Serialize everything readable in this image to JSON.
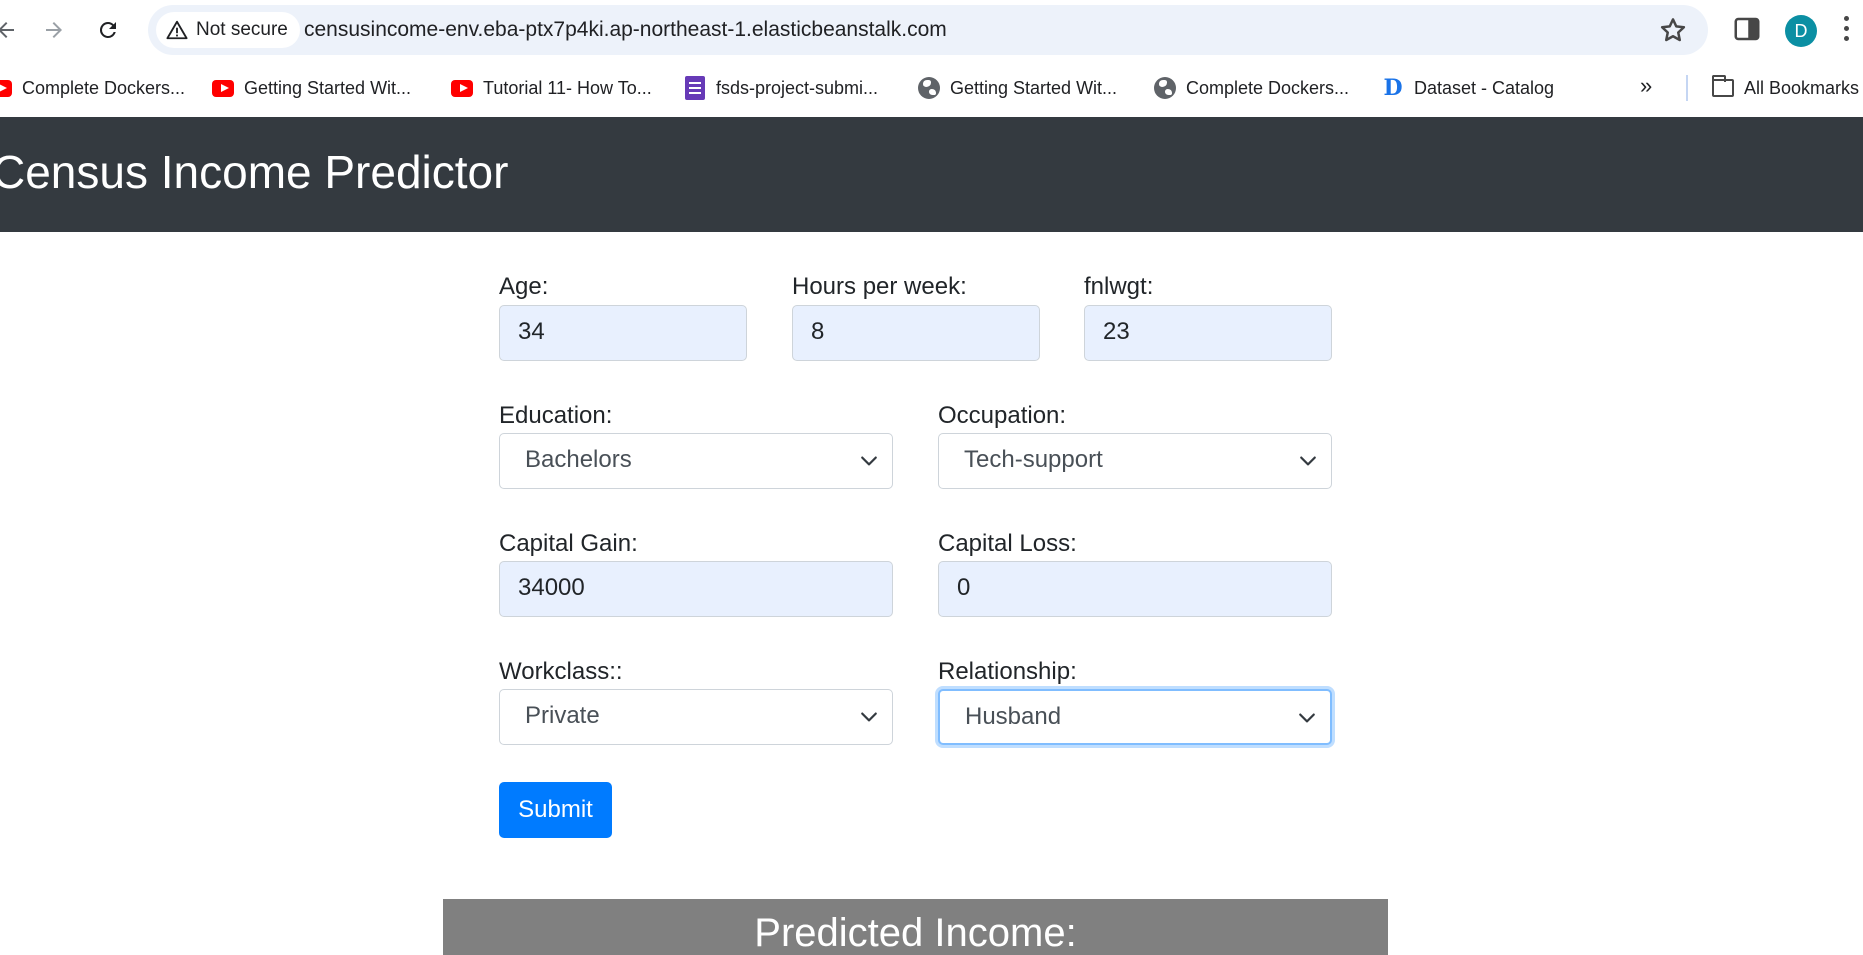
{
  "browser": {
    "security_label": "Not secure",
    "url": "censusincome-env.eba-ptx7p4ki.ap-northeast-1.elasticbeanstalk.com",
    "profile_initial": "D",
    "bookmarks": [
      {
        "label": "Complete Dockers...",
        "icon": "youtube-icon"
      },
      {
        "label": "Getting Started Wit...",
        "icon": "youtube-icon"
      },
      {
        "label": "Tutorial 11- How To...",
        "icon": "youtube-icon"
      },
      {
        "label": "fsds-project-submi...",
        "icon": "google-forms-icon"
      },
      {
        "label": "Getting Started Wit...",
        "icon": "globe-icon"
      },
      {
        "label": "Complete Dockers...",
        "icon": "globe-icon"
      },
      {
        "label": "Dataset - Catalog",
        "icon": "dataset-icon"
      }
    ],
    "more_bookmarks": "»",
    "all_bookmarks": "All Bookmarks"
  },
  "header": {
    "title": "Census Income Predictor"
  },
  "form": {
    "age": {
      "label": "Age:",
      "value": "34"
    },
    "hours": {
      "label": "Hours per week:",
      "value": "8"
    },
    "fnlwgt": {
      "label": "fnlwgt:",
      "value": "23"
    },
    "education": {
      "label": "Education:",
      "value": "Bachelors"
    },
    "occupation": {
      "label": "Occupation:",
      "value": "Tech-support"
    },
    "capital_gain": {
      "label": "Capital Gain:",
      "value": "34000"
    },
    "capital_loss": {
      "label": "Capital Loss:",
      "value": "0"
    },
    "workclass": {
      "label": "Workclass::",
      "value": "Private"
    },
    "relationship": {
      "label": "Relationship:",
      "value": "Husband"
    },
    "submit_label": "Submit"
  },
  "result": {
    "title": "Predicted Income:"
  },
  "colors": {
    "header_bg": "#343a40",
    "input_autofill_bg": "#e8f0fe",
    "primary": "#007bff",
    "result_bg": "#808080"
  }
}
